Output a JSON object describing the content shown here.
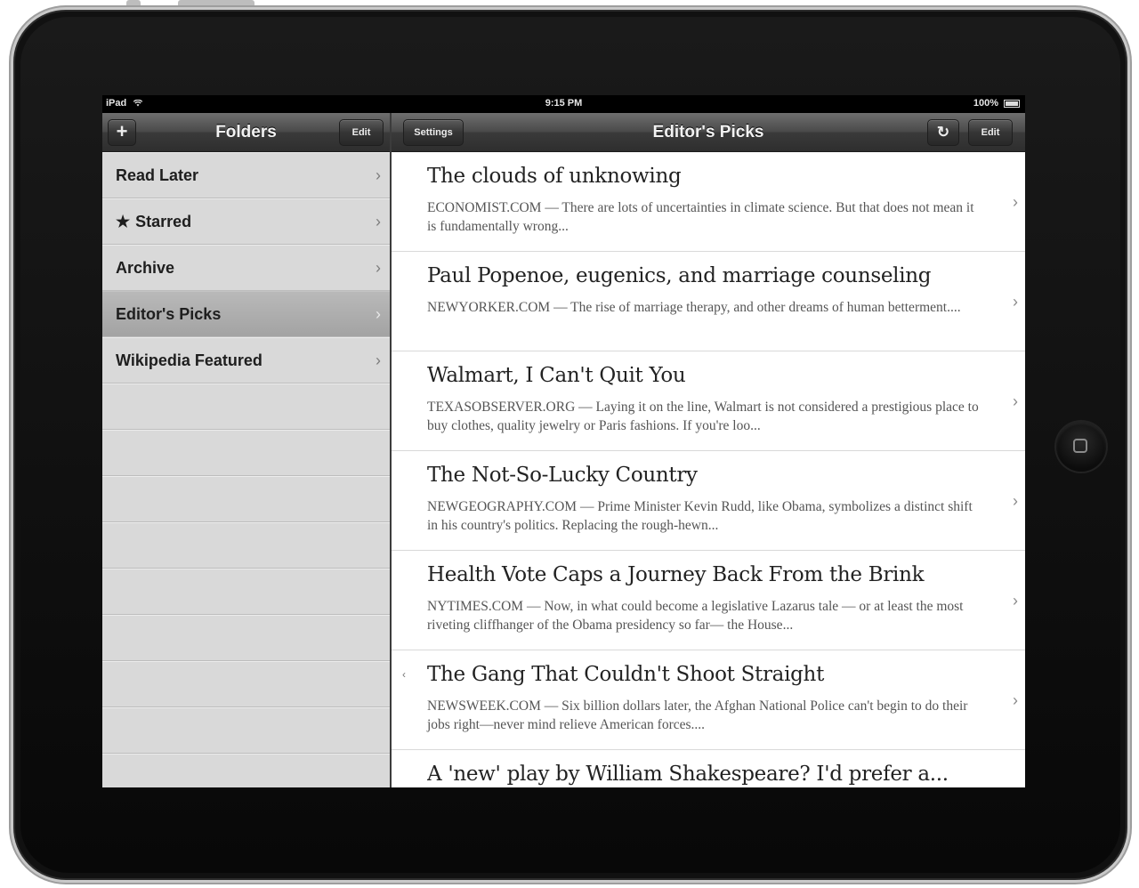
{
  "status_bar": {
    "device": "iPad",
    "time": "9:15 PM",
    "battery": "100%",
    "battery_level": 1.0
  },
  "left_pane": {
    "add_button": "+",
    "title": "Folders",
    "edit_button": "Edit",
    "folders": [
      {
        "label": "Read Later",
        "icon": "",
        "selected": false
      },
      {
        "label": "Starred",
        "icon": "★",
        "selected": false
      },
      {
        "label": "Archive",
        "icon": "",
        "selected": false
      },
      {
        "label": "Editor's Picks",
        "icon": "",
        "selected": true
      },
      {
        "label": "Wikipedia Featured",
        "icon": "",
        "selected": false
      }
    ],
    "chevron": "›"
  },
  "right_pane": {
    "settings_button": "Settings",
    "title": "Editor's Picks",
    "refresh_icon": "↻",
    "edit_button": "Edit",
    "articles": [
      {
        "title": "The clouds of unknowing",
        "summary": "ECONOMIST.COM — There are lots of uncertainties in climate science. But that does not mean it is fundamentally wrong..."
      },
      {
        "title": "Paul Popenoe, eugenics, and marriage counseling",
        "summary": "NEWYORKER.COM — The rise of marriage therapy, and other dreams of human betterment...."
      },
      {
        "title": "Walmart, I Can't Quit You",
        "summary": "TEXASOBSERVER.ORG — Laying it on the line, Walmart is not considered a prestigious place to buy clothes, quality jewelry or Paris fashions. If you're loo..."
      },
      {
        "title": "The Not-So-Lucky Country",
        "summary": "NEWGEOGRAPHY.COM — Prime Minister Kevin Rudd, like Obama, symbolizes a distinct shift in his country's politics. Replacing the rough-hewn..."
      },
      {
        "title": "Health Vote Caps a Journey Back From the Brink",
        "summary": "NYTIMES.COM — Now, in what could become a legislative Lazarus tale — or at least the most riveting cliffhanger of the Obama presidency so far— the House..."
      },
      {
        "title": "The Gang That Couldn't Shoot Straight",
        "summary": "NEWSWEEK.COM — Six billion dollars later, the Afghan National Police can't begin to do their jobs right—never mind relieve American forces...."
      },
      {
        "title": "A 'new' play by William Shakespeare? I'd prefer a...",
        "summary": ""
      }
    ],
    "chevron": "›",
    "unread_mark": "‹"
  }
}
